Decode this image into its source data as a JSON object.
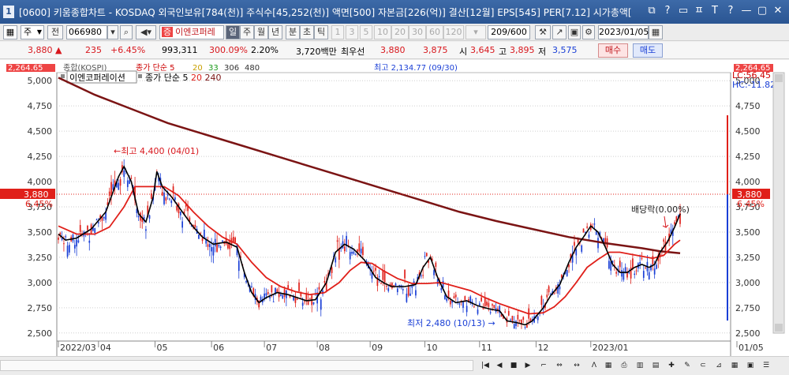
{
  "window": {
    "number": "1",
    "title": "[0600] 키움종합차트 - KOSDAQ 외국인보유[784(천)] 주식수[45,252(천)] 액면[500] 자본금[226(억)] 결산[12월] EPS[545] PER[7.12] 시가총액[",
    "buttons": [
      "⧉",
      "?",
      "▭",
      "ㅍ",
      "T",
      "?",
      "—",
      "▢",
      "✕"
    ]
  },
  "toolbar": {
    "period_select": "주",
    "prev_label": "전",
    "stock_code": "066980",
    "stock_name": "이엔코퍼레",
    "period_tabs": [
      "일",
      "주",
      "월",
      "년",
      "분",
      "초",
      "틱"
    ],
    "period_active": "일",
    "minute_values": [
      "1",
      "3",
      "5",
      "10",
      "20",
      "30",
      "60",
      "120"
    ],
    "count": "209/600",
    "date": "2023/01/05"
  },
  "quote": {
    "price": "3,880",
    "change": "235",
    "change_pct": "+6.45%",
    "volume": "993,311",
    "volume_ratio": "300.09%",
    "pct2": "2.20%",
    "amount": "3,720백만",
    "best_ask_label": "최우선",
    "best_ask": "3,880",
    "best_bid": "3,875",
    "open_label": "시",
    "open": "3,645",
    "high_label": "고",
    "high": "3,895",
    "low_label": "저",
    "low": "3,575",
    "buy_label": "매수",
    "sell_label": "매도"
  },
  "colors": {
    "up": "#d8171d",
    "down": "#1a3fd6",
    "ma5": "#000000",
    "ma20": "#e0201a",
    "ma240": "#7b1414"
  },
  "chart_data": {
    "type": "candlestick",
    "overlay_legend_row": [
      "종합(KOSPI)",
      "종가 단순 5",
      "20",
      "33",
      "306",
      "480"
    ],
    "overlay_high_label": "최고 2,134.77 (09/30)",
    "overlay_left_value": "2,264.65",
    "overlay_right_value": "2,264.65",
    "legend": {
      "name": "이엔코퍼레이션",
      "ma_label": "종가 단순",
      "periods": [
        "5",
        "20",
        "240"
      ]
    },
    "right_lc": "LC:56.45",
    "right_hc": "HC:-11.82",
    "current_price_label": "3,880",
    "current_pct_label": "6.45%",
    "high_annotation": "최고 4,400 (04/01)",
    "low_annotation": "최저 2,480 (10/13)",
    "dividend_annotation": "배당락(0.00%)",
    "y_ticks": [
      "5,000",
      "4,750",
      "4,500",
      "4,250",
      "4,000",
      "3,750",
      "3,500",
      "3,250",
      "3,000",
      "2,750",
      "2,500"
    ],
    "y_values": [
      5000,
      4750,
      4500,
      4250,
      4000,
      3750,
      3500,
      3250,
      3000,
      2750,
      2500
    ],
    "x_ticks": [
      "2022/03",
      "04",
      "05",
      "06",
      "07",
      "08",
      "09",
      "10",
      "11",
      "12",
      "2023/01",
      "01/05"
    ],
    "ylim": [
      2420,
      5080
    ],
    "ma5_path": [
      [
        0,
        3480
      ],
      [
        4,
        3420
      ],
      [
        10,
        3440
      ],
      [
        18,
        3530
      ],
      [
        26,
        3700
      ],
      [
        33,
        4050
      ],
      [
        36,
        4150
      ],
      [
        40,
        4000
      ],
      [
        44,
        3680
      ],
      [
        48,
        3600
      ],
      [
        52,
        3850
      ],
      [
        54,
        4100
      ],
      [
        57,
        3950
      ],
      [
        62,
        3850
      ],
      [
        68,
        3700
      ],
      [
        74,
        3550
      ],
      [
        79,
        3450
      ],
      [
        85,
        3380
      ],
      [
        92,
        3400
      ],
      [
        98,
        3350
      ],
      [
        102,
        3100
      ],
      [
        106,
        2900
      ],
      [
        110,
        2800
      ],
      [
        114,
        2850
      ],
      [
        120,
        2900
      ],
      [
        126,
        2880
      ],
      [
        131,
        2850
      ],
      [
        136,
        2820
      ],
      [
        141,
        2830
      ],
      [
        147,
        3000
      ],
      [
        152,
        3300
      ],
      [
        157,
        3380
      ],
      [
        162,
        3330
      ],
      [
        168,
        3220
      ],
      [
        174,
        3050
      ],
      [
        179,
        2990
      ],
      [
        183,
        2960
      ],
      [
        190,
        2960
      ],
      [
        196,
        2980
      ],
      [
        200,
        3150
      ],
      [
        204,
        3250
      ],
      [
        208,
        3050
      ],
      [
        213,
        2860
      ],
      [
        218,
        2800
      ],
      [
        224,
        2820
      ],
      [
        230,
        2770
      ],
      [
        236,
        2740
      ],
      [
        242,
        2720
      ],
      [
        246,
        2620
      ],
      [
        252,
        2600
      ],
      [
        256,
        2580
      ],
      [
        260,
        2620
      ],
      [
        266,
        2750
      ],
      [
        270,
        2870
      ],
      [
        275,
        2980
      ],
      [
        280,
        3200
      ],
      [
        284,
        3350
      ],
      [
        288,
        3450
      ],
      [
        292,
        3560
      ],
      [
        296,
        3500
      ],
      [
        300,
        3350
      ],
      [
        304,
        3180
      ],
      [
        308,
        3100
      ],
      [
        312,
        3100
      ],
      [
        316,
        3150
      ],
      [
        320,
        3180
      ],
      [
        324,
        3150
      ],
      [
        327,
        3180
      ],
      [
        330,
        3300
      ],
      [
        334,
        3400
      ],
      [
        338,
        3550
      ],
      [
        341,
        3680
      ]
    ],
    "ma20_path": [
      [
        0,
        3560
      ],
      [
        10,
        3480
      ],
      [
        20,
        3480
      ],
      [
        28,
        3550
      ],
      [
        36,
        3750
      ],
      [
        42,
        3950
      ],
      [
        50,
        3950
      ],
      [
        58,
        3950
      ],
      [
        66,
        3860
      ],
      [
        74,
        3700
      ],
      [
        82,
        3560
      ],
      [
        90,
        3450
      ],
      [
        98,
        3380
      ],
      [
        106,
        3200
      ],
      [
        114,
        3050
      ],
      [
        122,
        2960
      ],
      [
        130,
        2910
      ],
      [
        138,
        2880
      ],
      [
        146,
        2900
      ],
      [
        154,
        3000
      ],
      [
        160,
        3120
      ],
      [
        166,
        3200
      ],
      [
        172,
        3190
      ],
      [
        178,
        3120
      ],
      [
        186,
        3040
      ],
      [
        194,
        2990
      ],
      [
        202,
        2990
      ],
      [
        210,
        3000
      ],
      [
        218,
        2960
      ],
      [
        226,
        2920
      ],
      [
        234,
        2850
      ],
      [
        242,
        2790
      ],
      [
        250,
        2740
      ],
      [
        258,
        2690
      ],
      [
        266,
        2700
      ],
      [
        272,
        2760
      ],
      [
        278,
        2860
      ],
      [
        284,
        3000
      ],
      [
        290,
        3150
      ],
      [
        296,
        3230
      ],
      [
        302,
        3300
      ],
      [
        308,
        3300
      ],
      [
        314,
        3280
      ],
      [
        320,
        3260
      ],
      [
        326,
        3240
      ],
      [
        332,
        3270
      ],
      [
        338,
        3380
      ],
      [
        341,
        3420
      ]
    ],
    "ma240_path": [
      [
        0,
        5030
      ],
      [
        20,
        4860
      ],
      [
        40,
        4720
      ],
      [
        60,
        4580
      ],
      [
        80,
        4470
      ],
      [
        100,
        4360
      ],
      [
        120,
        4250
      ],
      [
        140,
        4140
      ],
      [
        160,
        4030
      ],
      [
        180,
        3920
      ],
      [
        200,
        3810
      ],
      [
        220,
        3700
      ],
      [
        240,
        3610
      ],
      [
        260,
        3530
      ],
      [
        280,
        3450
      ],
      [
        300,
        3390
      ],
      [
        320,
        3340
      ],
      [
        330,
        3310
      ],
      [
        341,
        3290
      ]
    ]
  }
}
